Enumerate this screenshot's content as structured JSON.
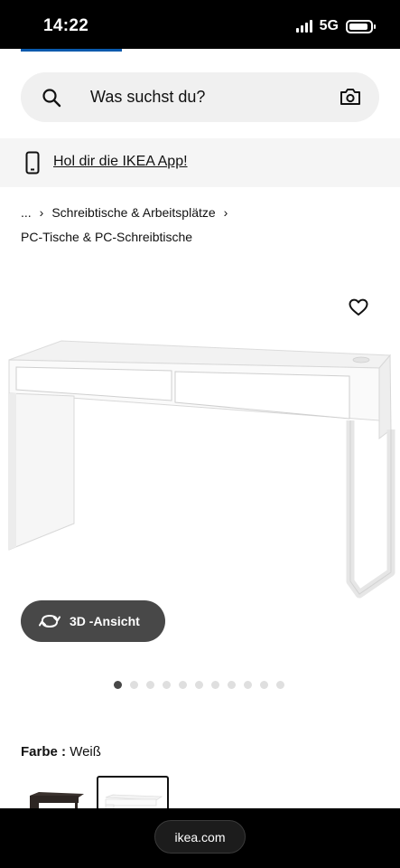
{
  "status_bar": {
    "time": "14:22",
    "network": "5G",
    "battery_level": 0.9,
    "signal_icon": "signal-bars-icon",
    "battery_icon": "battery-icon"
  },
  "search": {
    "placeholder": "Was suchst du?",
    "search_icon": "search-icon",
    "camera_icon": "camera-icon"
  },
  "app_banner": {
    "icon": "smartphone-icon",
    "link_text": "Hol dir die IKEA App!"
  },
  "breadcrumb": {
    "ellipsis": "...",
    "separator": "›",
    "items": [
      "Schreibtische & Arbeitsplätze",
      "PC-Tische & PC-Schreibtische"
    ]
  },
  "product": {
    "favorite_icon": "heart-icon",
    "view_3d_label": "3D -Ansicht",
    "view_3d_icon": "rotate-icon",
    "image_count": 11,
    "active_image": 1,
    "color_label": "Farbe :",
    "color_value": "Weiß",
    "variants": [
      "schwarzbraun",
      "weiß"
    ],
    "selected_variant": 1
  },
  "browser": {
    "url": "ikea.com"
  },
  "colors": {
    "accent_blue": "#0a5aad",
    "button_dark": "#484848",
    "search_bg": "#f0f0f0",
    "banner_bg": "#f5f5f5"
  }
}
